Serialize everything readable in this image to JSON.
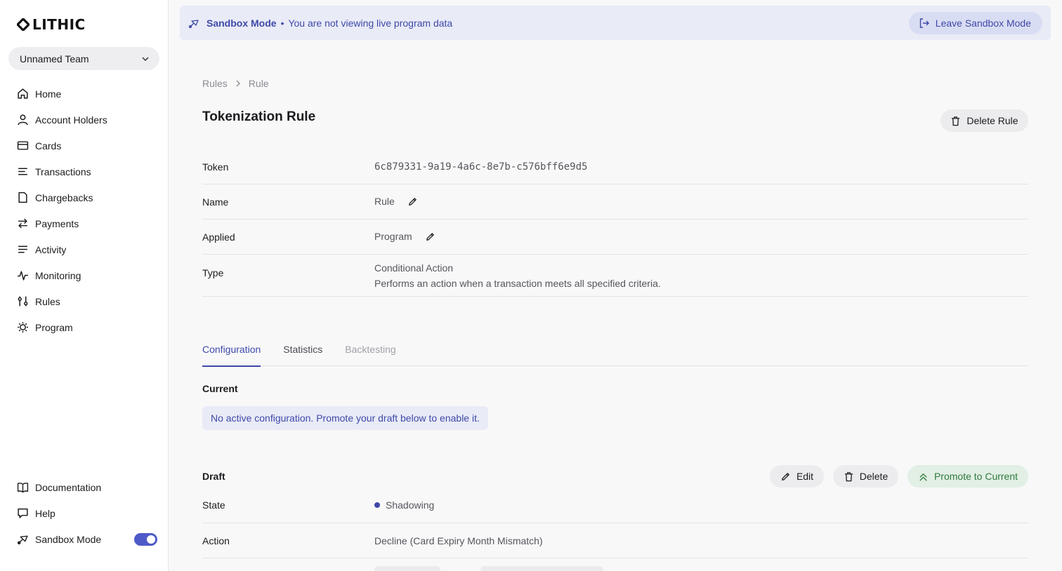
{
  "brand": {
    "name": "LITHIC"
  },
  "team": {
    "name": "Unnamed Team"
  },
  "nav": {
    "items": [
      {
        "label": "Home",
        "icon": "home-icon"
      },
      {
        "label": "Account Holders",
        "icon": "user-icon"
      },
      {
        "label": "Cards",
        "icon": "card-icon"
      },
      {
        "label": "Transactions",
        "icon": "list-icon"
      },
      {
        "label": "Chargebacks",
        "icon": "file-icon"
      },
      {
        "label": "Payments",
        "icon": "arrows-icon"
      },
      {
        "label": "Activity",
        "icon": "lines-icon"
      },
      {
        "label": "Monitoring",
        "icon": "pulse-icon"
      },
      {
        "label": "Rules",
        "icon": "sliders-icon"
      },
      {
        "label": "Program",
        "icon": "gear-icon"
      }
    ],
    "bottom": [
      {
        "label": "Documentation",
        "icon": "book-icon"
      },
      {
        "label": "Help",
        "icon": "chat-icon"
      },
      {
        "label": "Sandbox Mode",
        "icon": "sandbox-icon",
        "toggle_on": true
      }
    ]
  },
  "banner": {
    "title": "Sandbox Mode",
    "separator": "•",
    "message": "You are not viewing live program data",
    "leave_label": "Leave Sandbox Mode"
  },
  "breadcrumb": [
    "Rules",
    "Rule"
  ],
  "page": {
    "title": "Tokenization Rule",
    "delete_label": "Delete Rule"
  },
  "details": {
    "token_label": "Token",
    "token_value": "6c879331-9a19-4a6c-8e7b-c576bff6e9d5",
    "name_label": "Name",
    "name_value": "Rule",
    "applied_label": "Applied",
    "applied_value": "Program",
    "type_label": "Type",
    "type_value": "Conditional Action",
    "type_description": "Performs an action when a transaction meets all specified criteria."
  },
  "tabs": [
    {
      "label": "Configuration",
      "state": "active"
    },
    {
      "label": "Statistics",
      "state": "normal"
    },
    {
      "label": "Backtesting",
      "state": "muted"
    }
  ],
  "current": {
    "label": "Current",
    "notice": "No active configuration. Promote your draft below to enable it."
  },
  "draft": {
    "label": "Draft",
    "edit_label": "Edit",
    "delete_label": "Delete",
    "promote_label": "Promote to Current",
    "state_label": "State",
    "state_value": "Shadowing",
    "action_label": "Action",
    "action_value": "Decline (Card Expiry Month Mismatch)"
  },
  "colors": {
    "accent": "#3e49a8",
    "banner_bg": "#e9ebf7",
    "promote_bg": "#e2efe4",
    "promote_text": "#2f7a3f",
    "toggle": "#4f5ac9"
  }
}
